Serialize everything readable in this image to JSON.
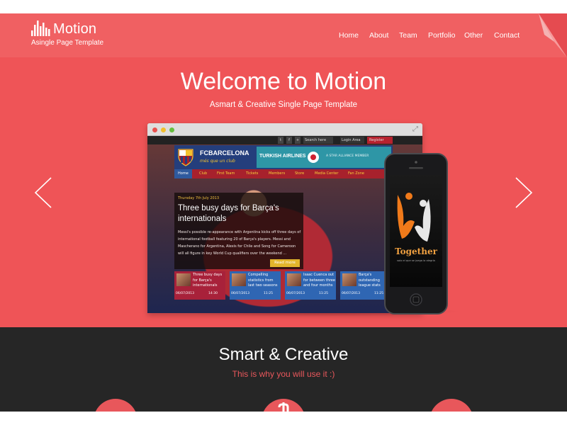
{
  "brand": {
    "name": "Motion",
    "tagline": "Asingle Page Template",
    "accent": "#f06062"
  },
  "nav": {
    "items": [
      "Home",
      "About",
      "Team",
      "Portfolio",
      "Other",
      "Contact"
    ]
  },
  "hero": {
    "title": "Welcome to Motion",
    "subtitle": "Asmart & Creative Single Page Template",
    "background": "#ef5457"
  },
  "mockup": {
    "topbar": {
      "social_icons": [
        "twitter-icon",
        "facebook-icon",
        "plus-icon"
      ],
      "search_placeholder": "Search here",
      "login": "Login Area",
      "register": "Register"
    },
    "club": {
      "name": "FCBARCELONA",
      "motto": "més que un club"
    },
    "sponsor": {
      "name": "TURKISH AIRLINES",
      "alliance": "A STAR ALLIANCE MEMBER"
    },
    "menu": [
      "Home",
      "Club",
      "First Team",
      "Tickets",
      "Members",
      "Store",
      "Media Center",
      "Fan Zone"
    ],
    "article": {
      "date": "Thursday 7th July 2013",
      "title": "Three busy days for Barça's internationals",
      "body": "Messi's possible re-appearance with Argentina kicks off three days of international football featuring 20 of Barça's players. Messi and Mascherano for Argentina, Alexis for Chile and Song for Cameroon will all figure in key World Cup qualifiers over the weekend ...",
      "read_more": "Read more"
    },
    "thumbs": [
      {
        "text": "Three busy days for Barça's internationals",
        "date": "06/07/2013",
        "time": "14:30",
        "color": "#a8213a"
      },
      {
        "text": "Compelling statistics from last two seasons",
        "date": "06/07/2013",
        "time": "11:25",
        "color": "#2f66b3"
      },
      {
        "text": "Isaac Cuenca out for between three and four months",
        "date": "06/07/2013",
        "time": "11:25",
        "color": "#2f66b3"
      },
      {
        "text": "Barça's outstanding league stats",
        "date": "06/07/2013",
        "time": "11:25",
        "color": "#2f66b3"
      }
    ]
  },
  "phone_app": {
    "name": "Together",
    "tagline": "solo el que se juega la alegría"
  },
  "section": {
    "title": "Smart & Creative",
    "subtitle": "This is why you will use it :)",
    "background": "#262626",
    "accent": "#e8575b"
  }
}
